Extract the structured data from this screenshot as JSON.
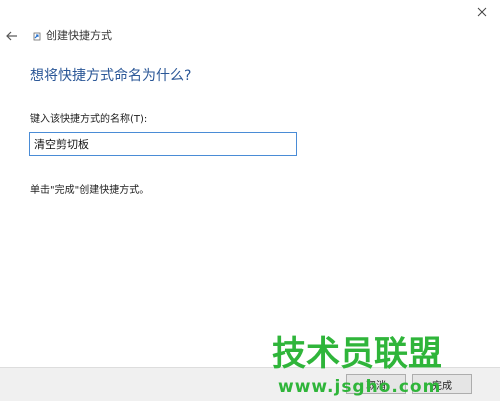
{
  "window": {
    "title": "创建快捷方式",
    "close_icon": "close-icon",
    "back_icon": "back-arrow-icon",
    "shortcut_icon": "shortcut-arrow-icon"
  },
  "main": {
    "question": "想将快捷方式命名为什么?",
    "field_label": "键入该快捷方式的名称(T):",
    "name_value": "清空剪切板",
    "hint": "单击\"完成\"创建快捷方式。"
  },
  "footer": {
    "finish_label": "完成",
    "cancel_label": "取消"
  },
  "watermark": {
    "title": "技术员联盟",
    "url": "www.jsgho.com"
  },
  "colors": {
    "heading": "#2b5797",
    "input_border": "#4a8cd6",
    "watermark": "#2fb53a"
  }
}
